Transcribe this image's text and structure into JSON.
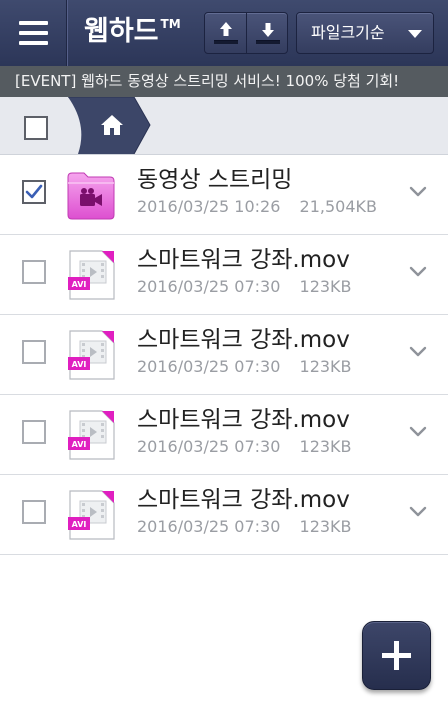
{
  "header": {
    "title": "웹하드",
    "trademark": "TM",
    "menu_icon": "hamburger-menu-icon",
    "upload_icon": "upload-arrow-icon",
    "download_icon": "download-arrow-icon",
    "sort_label": "파일크기순",
    "sort_caret_icon": "caret-down-icon"
  },
  "banner": {
    "text": "[EVENT] 웹하드 동영상 스트리밍 서비스! 100% 당첨 기회!"
  },
  "breadcrumb": {
    "home_icon": "home-icon"
  },
  "files": [
    {
      "name": "동영상 스트리밍",
      "date": "2016/03/25 10:26",
      "size": "21,504KB",
      "type": "folder",
      "checked": true,
      "badge": ""
    },
    {
      "name": "스마트워크 강좌.mov",
      "date": "2016/03/25 07:30",
      "size": "123KB",
      "type": "video",
      "checked": false,
      "badge": "AVI"
    },
    {
      "name": "스마트워크 강좌.mov",
      "date": "2016/03/25 07:30",
      "size": "123KB",
      "type": "video",
      "checked": false,
      "badge": "AVI"
    },
    {
      "name": "스마트워크 강좌.mov",
      "date": "2016/03/25 07:30",
      "size": "123KB",
      "type": "video",
      "checked": false,
      "badge": "AVI"
    },
    {
      "name": "스마트워크 강좌.mov",
      "date": "2016/03/25 07:30",
      "size": "123KB",
      "type": "video",
      "checked": false,
      "badge": "AVI"
    }
  ],
  "fab": {
    "icon": "plus-icon"
  },
  "colors": {
    "header_bg": "#2f395c",
    "banner_bg": "#555b60",
    "accent_magenta": "#e01fc0",
    "checkbox_blue": "#3a5fb5"
  }
}
